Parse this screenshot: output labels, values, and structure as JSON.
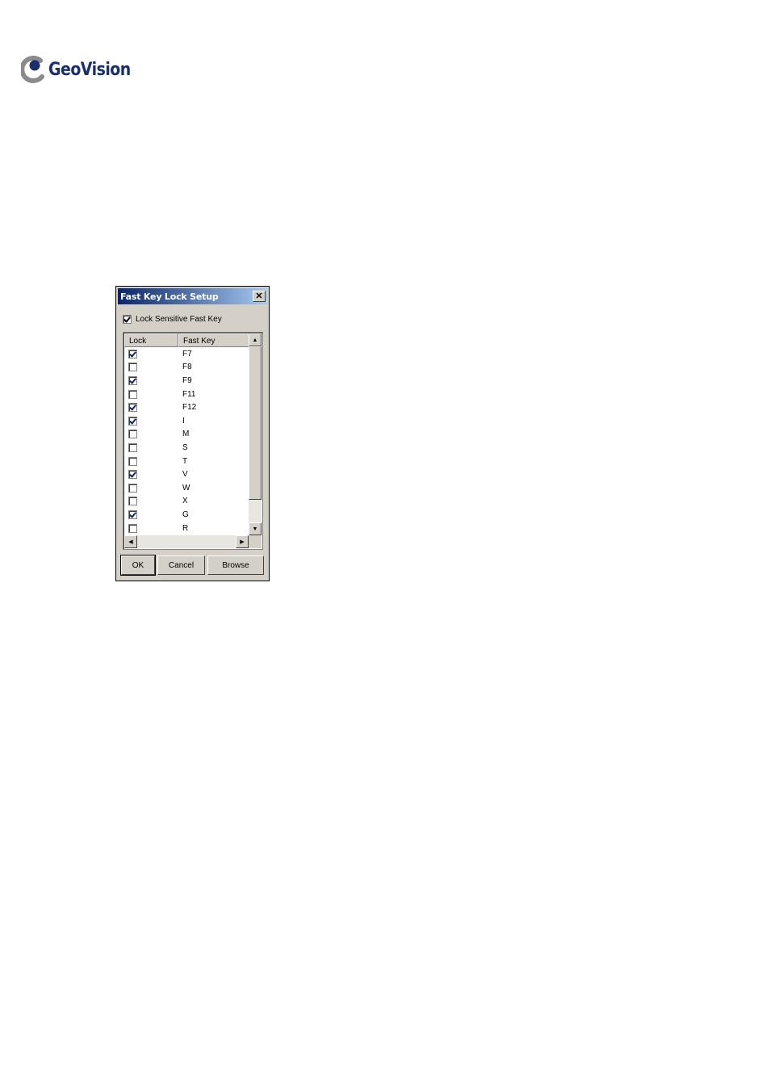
{
  "logo": {
    "name": "GeoVision"
  },
  "dialog": {
    "title": "Fast Key Lock Setup",
    "close_glyph": "✕",
    "lock_all": {
      "label": "Lock Sensitive Fast Key",
      "checked": true
    },
    "columns": [
      "Lock",
      "Fast Key"
    ],
    "rows": [
      {
        "key": "F7",
        "locked": true
      },
      {
        "key": "F8",
        "locked": false
      },
      {
        "key": "F9",
        "locked": true
      },
      {
        "key": "F11",
        "locked": false
      },
      {
        "key": "F12",
        "locked": true
      },
      {
        "key": "I",
        "locked": true
      },
      {
        "key": "M",
        "locked": false
      },
      {
        "key": "S",
        "locked": false
      },
      {
        "key": "T",
        "locked": false
      },
      {
        "key": "V",
        "locked": true
      },
      {
        "key": "W",
        "locked": false
      },
      {
        "key": "X",
        "locked": false
      },
      {
        "key": "G",
        "locked": true
      },
      {
        "key": "R",
        "locked": false
      }
    ],
    "buttons": {
      "ok": "OK",
      "cancel": "Cancel",
      "browse": "Browse"
    },
    "scroll_glyphs": {
      "up": "▲",
      "down": "▼",
      "left": "◀",
      "right": "▶"
    }
  },
  "colors": {
    "title_start": "#0a246a",
    "title_end": "#a6caf0",
    "face": "#d4d0c8",
    "logo": "#1a2f6e"
  }
}
